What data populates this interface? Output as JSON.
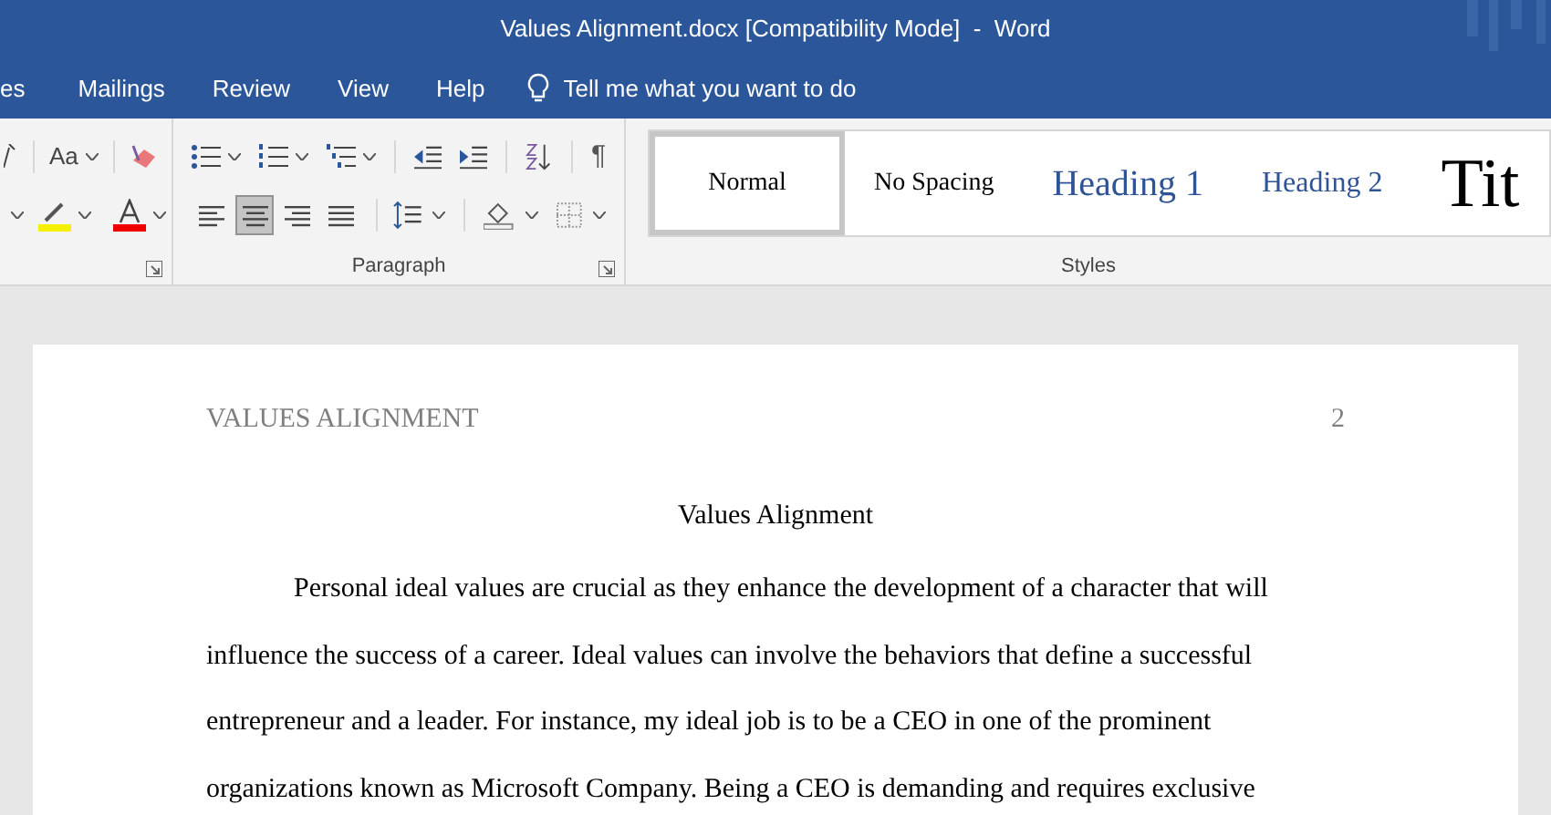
{
  "window": {
    "title": "Values Alignment.docx [Compatibility Mode]  -  Word"
  },
  "tabs": [
    {
      "label": "es",
      "selected": false
    },
    {
      "label": "Mailings",
      "selected": false
    },
    {
      "label": "Review",
      "selected": false
    },
    {
      "label": "View",
      "selected": false
    },
    {
      "label": "Help",
      "selected": false
    }
  ],
  "tell_me": {
    "placeholder": "Tell me what you want to do"
  },
  "font_group": {
    "case_label": "Aa"
  },
  "paragraph_group": {
    "label": "Paragraph",
    "pilcrow": "¶",
    "alignments": [
      {
        "kind": "left",
        "selected": false
      },
      {
        "kind": "center",
        "selected": true
      },
      {
        "kind": "right",
        "selected": false
      },
      {
        "kind": "justify",
        "selected": false
      }
    ]
  },
  "styles_group": {
    "label": "Styles",
    "styles": [
      {
        "kind": "normal",
        "label": "Normal",
        "selected": true
      },
      {
        "kind": "nospacing",
        "label": "No Spacing",
        "selected": false
      },
      {
        "kind": "h1",
        "label": "Heading 1",
        "selected": false
      },
      {
        "kind": "h2",
        "label": "Heading 2",
        "selected": false
      },
      {
        "kind": "title",
        "label": "Tit",
        "selected": false
      }
    ]
  },
  "document": {
    "header": "VALUES ALIGNMENT",
    "page_number": "2",
    "title": "Values Alignment",
    "lines": [
      "Personal ideal values are crucial as they enhance the development of a character that will",
      "influence the success of a career. Ideal values can involve the behaviors that define a successful",
      "entrepreneur and a leader. For instance, my ideal job is to be a CEO in one of the prominent",
      "organizations known as Microsoft Company. Being a CEO is demanding and requires exclusive"
    ]
  }
}
